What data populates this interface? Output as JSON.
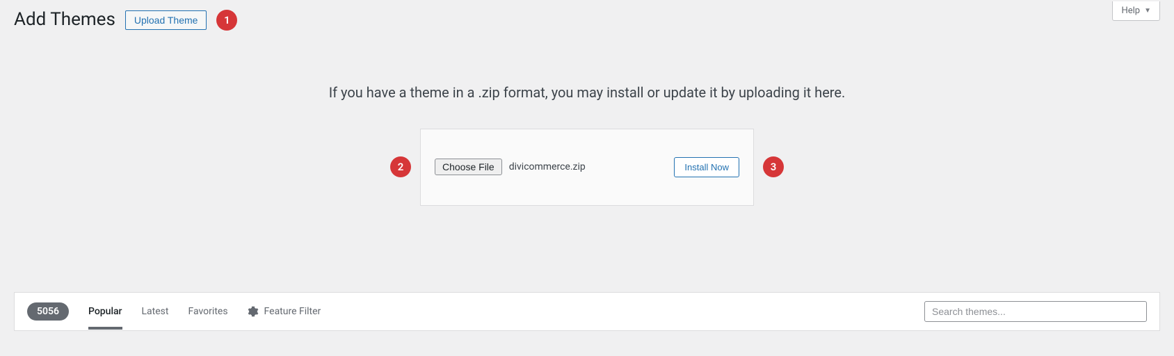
{
  "header": {
    "page_title": "Add Themes",
    "upload_button": "Upload Theme",
    "help_label": "Help"
  },
  "annotations": {
    "badge1": "1",
    "badge2": "2",
    "badge3": "3"
  },
  "upload": {
    "description": "If you have a theme in a .zip format, you may install or update it by uploading it here.",
    "choose_file_label": "Choose File",
    "selected_file": "divicommerce.zip",
    "install_label": "Install Now"
  },
  "filter": {
    "count": "5056",
    "tabs": {
      "popular": "Popular",
      "latest": "Latest",
      "favorites": "Favorites",
      "feature_filter": "Feature Filter"
    },
    "search_placeholder": "Search themes..."
  }
}
